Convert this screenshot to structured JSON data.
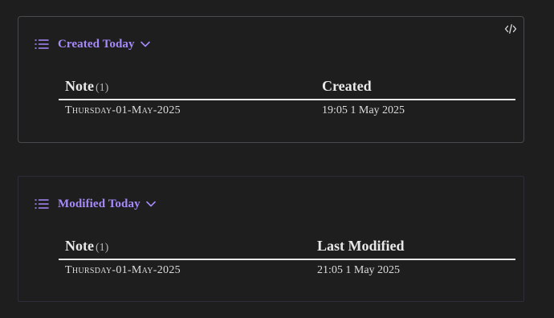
{
  "colors": {
    "background": "#1e1e1e",
    "accent": "#a68af9",
    "text": "#dcddde",
    "rule": "#e8e8e8"
  },
  "created_block": {
    "title": "Created Today",
    "icons": [
      "list-icon",
      "chevron-down-icon",
      "code-icon"
    ],
    "columns": {
      "note": "Note",
      "note_count": "(1)",
      "created": "Created"
    },
    "rows": [
      {
        "note": "Thursday-01-May-2025",
        "created": "19:05 1 May 2025"
      }
    ]
  },
  "modified_block": {
    "title": "Modified Today",
    "icons": [
      "list-icon",
      "chevron-down-icon"
    ],
    "columns": {
      "note": "Note",
      "note_count": "(1)",
      "modified": "Last Modified"
    },
    "rows": [
      {
        "note": "Thursday-01-May-2025",
        "modified": "21:05 1 May 2025"
      }
    ]
  }
}
